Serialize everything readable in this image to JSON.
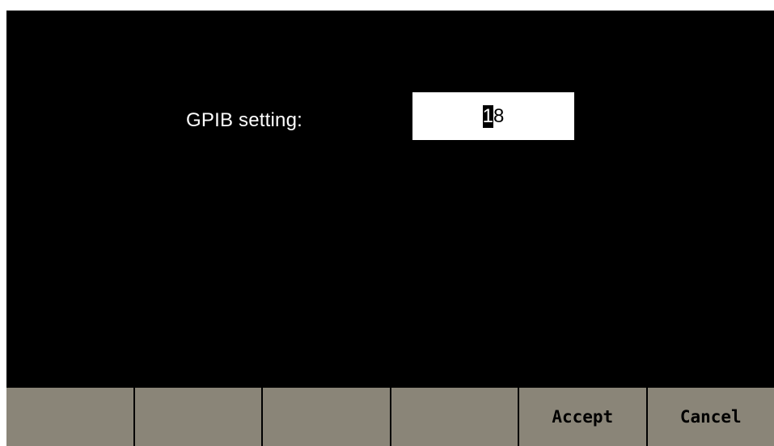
{
  "dialog": {
    "label": "GPIB setting:",
    "value_cursor_digit": "1",
    "value_rest": "8"
  },
  "softkeys": [
    {
      "label": ""
    },
    {
      "label": ""
    },
    {
      "label": ""
    },
    {
      "label": ""
    },
    {
      "label": "Accept"
    },
    {
      "label": "Cancel"
    }
  ],
  "colors": {
    "background": "#000000",
    "field": "#ffffff",
    "softkey": "#8a8578"
  }
}
